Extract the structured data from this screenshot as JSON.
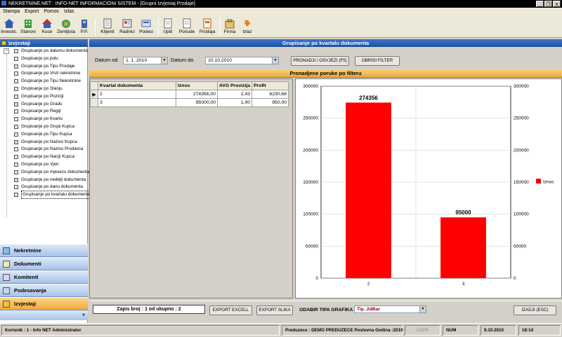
{
  "window": {
    "title": "NEKRETNINE.NET  :  INFO-NET INFORMACIONI SISTEM - [Grupni Izvjestaj Prodaje]",
    "controls": [
      "_",
      "❐",
      "x"
    ]
  },
  "menu": [
    "Stampa",
    "Export",
    "Pomoc",
    "Izlaz"
  ],
  "toolbar": [
    {
      "label": "Investic.",
      "icon": "house-icon",
      "color": "#2c5fb8"
    },
    {
      "label": "Stanovi",
      "icon": "apartment-icon",
      "color": "#3a9a3a"
    },
    {
      "label": "Kuce",
      "icon": "home-icon",
      "color": "#c03020"
    },
    {
      "label": "Zemljista",
      "icon": "land-icon",
      "color": "#3aa060"
    },
    {
      "label": "P.P.",
      "icon": "building-icon",
      "color": "#4060c0"
    },
    {
      "label": "Klijenti",
      "icon": "clients-icon",
      "color": "#8080a0"
    },
    {
      "label": "Radnici",
      "icon": "workers-icon",
      "color": "#a04040"
    },
    {
      "label": "Podesi",
      "icon": "settings-icon",
      "color": "#6080c0"
    },
    {
      "label": "Upiti",
      "icon": "inquiry-icon",
      "color": "#909090"
    },
    {
      "label": "Ponude",
      "icon": "offers-icon",
      "color": "#909090"
    },
    {
      "label": "Prodaja",
      "icon": "sales-icon",
      "color": "#c07030"
    },
    {
      "label": "Firma",
      "icon": "company-icon",
      "color": "#d09030"
    },
    {
      "label": "Izlaz",
      "icon": "exit-icon",
      "color": "#e08020"
    }
  ],
  "left_panel": {
    "header": "Izvjestaji",
    "tree_root_control": "−",
    "tree": [
      "Grupisanje po datumu dokumenta",
      "Grupisanje po polu",
      "Grupisanje po Tipu Prodaje",
      "Grupisanje po Vrsti nekretnine",
      "Grupisanje po Tipu Nekretnine",
      "Grupisanje po Stanju",
      "Grupisanje po Poziciji",
      "Grupisanje po Gradu",
      "Grupisanje po Regiji",
      "Grupisanje po Kvartu",
      "Grupisanje po Grupi Kupca",
      "Grupisanje po Tipu Kupca",
      "Grupisanje po Nazivu Kupca",
      "Grupisanje po Nazivu Prodavca",
      "Grupisanje po Naciji Kupca",
      "Grupisanje po Vjeri",
      "Grupisanje po mjesecu dokumenta",
      "Grupisanje po nedelji dokumenta",
      "Grupisanje po danu dokumenta",
      "Grupisanje po kvartalu dokumenta"
    ],
    "selected_index": 19,
    "nav": [
      {
        "label": "Nekretnine",
        "active": false
      },
      {
        "label": "Dokumenti",
        "active": false
      },
      {
        "label": "Komitenti",
        "active": false
      },
      {
        "label": "Podesavanja",
        "active": false
      },
      {
        "label": "Izvjestaji",
        "active": true
      }
    ],
    "nav_footer": "»"
  },
  "main": {
    "title": "Grupisanje po kvartalu dokumenta",
    "date_from_label": "Datum od",
    "date_from_value": "1. 1 .2010",
    "date_to_label": "Datum do",
    "date_to_value": "10.10.2010",
    "btn_find": "PRONADJI / OSVJEZI (F5)",
    "btn_clear": "OBRISI FILTER",
    "filter_banner": "Pronadjene poruke po filteru",
    "grid": {
      "columns": [
        "Kvartal dokumenta",
        "Iznos",
        "AVG Provizija",
        "Profit"
      ],
      "rows": [
        [
          "2",
          "274356,00",
          "2,43",
          "6230,68"
        ],
        [
          "3",
          "95000,00",
          "1,00",
          "950,00"
        ]
      ],
      "current_row_marker": "▶"
    },
    "record_info": "Zapis broj : 1 od ukupno : 2",
    "btn_export_excel": "EXPORT EXCELL",
    "btn_export_image": "EXPORT SLIKA",
    "chart_type_label": "ODABIR TIPA GRAFIKA",
    "chart_type_value": "Tip_2dBar",
    "btn_exit": "IZADJI (ESC)"
  },
  "chart_data": {
    "type": "bar",
    "categories": [
      "2",
      "3"
    ],
    "series": [
      {
        "name": "Iznos",
        "values": [
          274356,
          95000
        ],
        "color": "#ff0000"
      }
    ],
    "ylim": [
      0,
      300000
    ],
    "yticks": [
      0,
      50000,
      100000,
      150000,
      200000,
      250000,
      300000
    ],
    "data_labels": [
      "274356",
      "95000"
    ],
    "legend": "right",
    "grid": true,
    "secondary_axis": true
  },
  "status": {
    "user": "Korisnik : 1 - Info NET  Administrator",
    "company": "Preduzece : DEMO PREDUZECE   Poslovna Godina :2010",
    "caps": "CAPS",
    "num": "NUM",
    "date": "9.10.2010",
    "time": "18:14"
  }
}
